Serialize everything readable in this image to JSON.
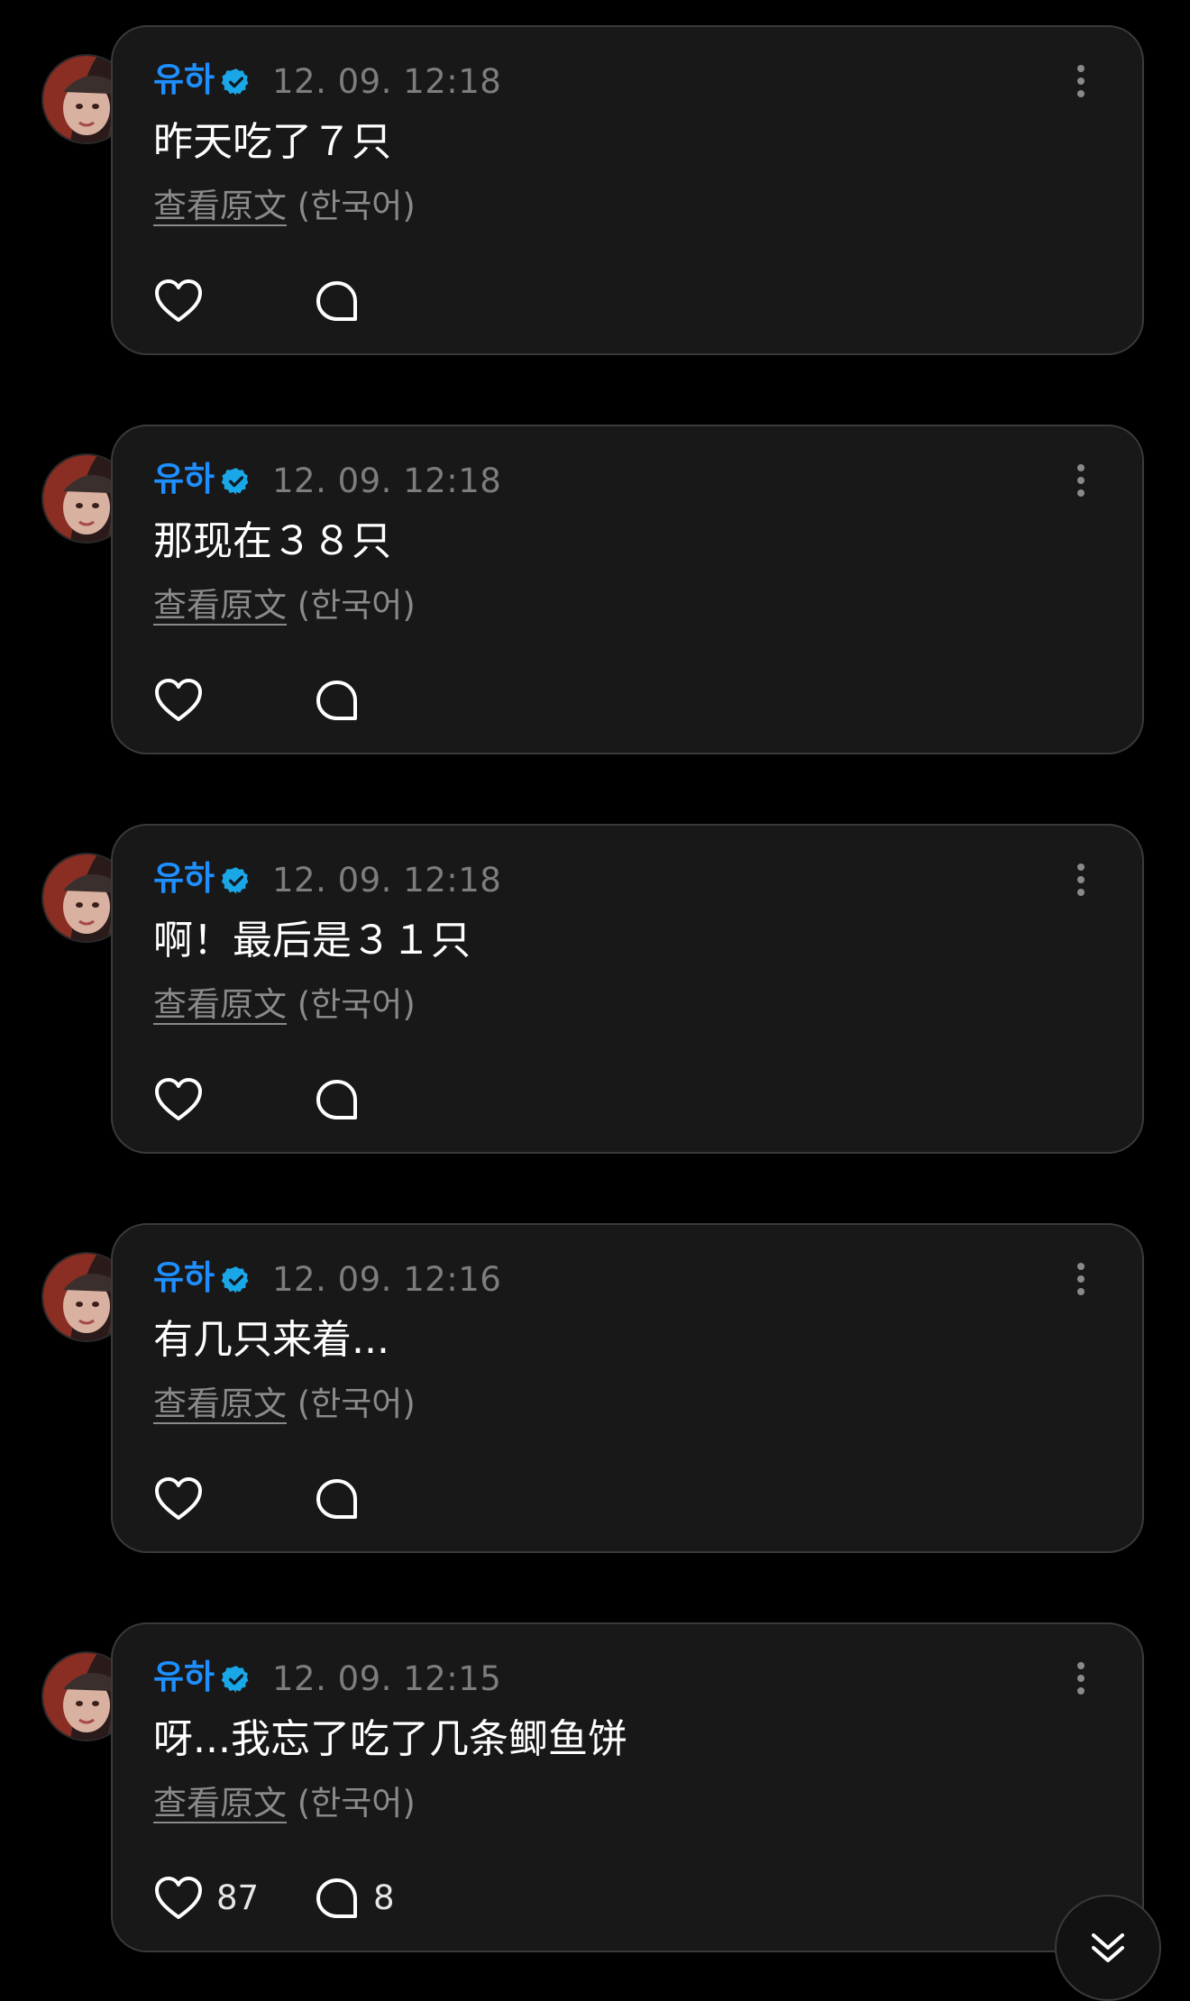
{
  "comments": [
    {
      "author": "유하",
      "time": "12. 09. 12:18",
      "text": "昨天吃了７只",
      "translate_link": "查看原文",
      "translate_lang": "(한국어)",
      "likes": "",
      "replies": ""
    },
    {
      "author": "유하",
      "time": "12. 09. 12:18",
      "text": "那现在３８只",
      "translate_link": "查看原文",
      "translate_lang": "(한국어)",
      "likes": "",
      "replies": ""
    },
    {
      "author": "유하",
      "time": "12. 09. 12:18",
      "text": "啊！最后是３１只",
      "translate_link": "查看原文",
      "translate_lang": "(한국어)",
      "likes": "",
      "replies": ""
    },
    {
      "author": "유하",
      "time": "12. 09. 12:16",
      "text": "有几只来着...",
      "translate_link": "查看原文",
      "translate_lang": "(한국어)",
      "likes": "",
      "replies": ""
    },
    {
      "author": "유하",
      "time": "12. 09. 12:15",
      "text": "呀...我忘了吃了几条鲫鱼饼",
      "translate_link": "查看原文",
      "translate_lang": "(한국어)",
      "likes": "87",
      "replies": "8"
    }
  ],
  "icons": {
    "verified": "verified-badge-icon",
    "more": "more-vertical-icon",
    "like": "heart-icon",
    "reply": "speech-bubble-icon",
    "scroll": "double-chevron-down-icon"
  },
  "colors": {
    "background": "#000000",
    "card": "#181818",
    "card_border": "#3a3a3a",
    "author": "#1e8fff",
    "verified": "#1aa7e8",
    "muted": "#8a8a8a"
  }
}
